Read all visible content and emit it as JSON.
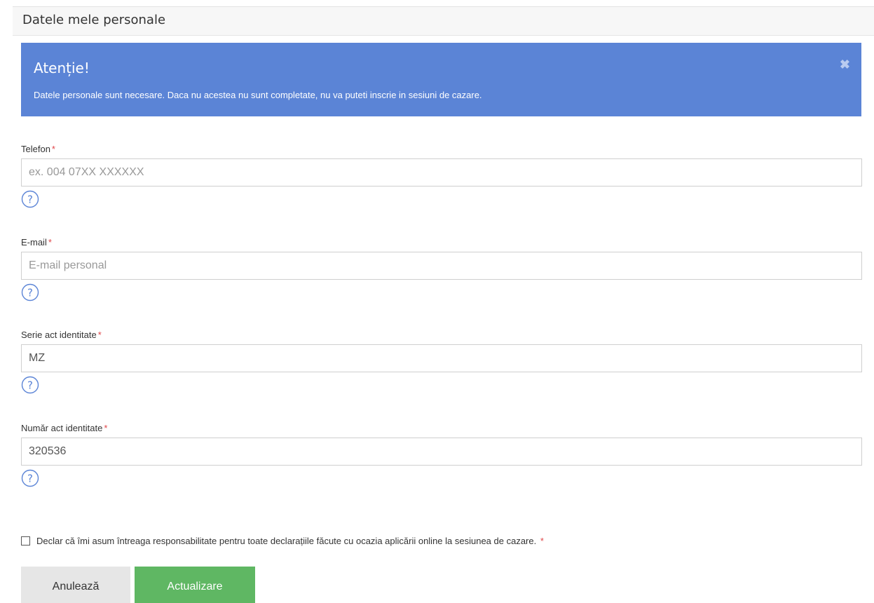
{
  "header": {
    "title": "Datele mele personale"
  },
  "alert": {
    "title": "Atenție!",
    "message": "Datele personale sunt necesare. Daca nu acestea nu sunt completate, nu va puteti inscrie in sesiuni de cazare.",
    "close_glyph": "✖"
  },
  "fields": [
    {
      "label": "Telefon",
      "required_mark": "*",
      "value": "",
      "placeholder": "ex. 004 07XX XXXXXX"
    },
    {
      "label": "E-mail",
      "required_mark": "*",
      "value": "",
      "placeholder": "E-mail personal"
    },
    {
      "label": "Serie act identitate",
      "required_mark": "*",
      "value": "MZ",
      "placeholder": ""
    },
    {
      "label": "Număr act identitate",
      "required_mark": "*",
      "value": "320536",
      "placeholder": ""
    }
  ],
  "declaration": {
    "text": "Declar că îmi asum întreaga responsabilitate pentru toate declarațiile făcute cu ocazia aplicării online la sesiunea de cazare.",
    "required_mark": "*",
    "checked": false
  },
  "buttons": {
    "cancel_label": "Anulează",
    "update_label": "Actualizare"
  },
  "icons": {
    "help": "question-circle-icon",
    "close": "close-icon"
  },
  "colors": {
    "alert_bg": "#5b84d6",
    "required": "#e0474a",
    "update_button": "#5fb763",
    "cancel_button": "#e6e6e6",
    "help_icon": "#5b84d6"
  }
}
